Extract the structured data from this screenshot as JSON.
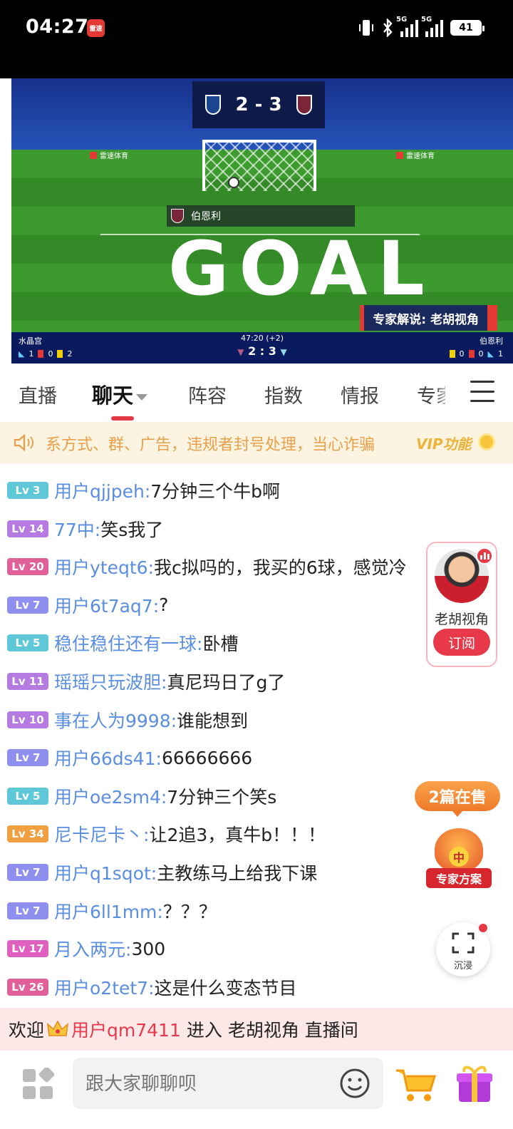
{
  "status_bar": {
    "time": "04:27",
    "app_icon_text": "雷速",
    "network_1": "5G",
    "network_2": "5G",
    "battery": "41"
  },
  "video": {
    "score": "2 - 3",
    "board_ad_text": "雷速体育",
    "scorer_team": "伯恩利",
    "goal_text": "GOAL",
    "expert_tag": "专家解说: 老胡视角",
    "home_team": "水晶宫",
    "away_team": "伯恩利",
    "match_time": "47:20 (+2)",
    "home_score": "2",
    "away_score": "3",
    "score_separator": ":",
    "home_stats": {
      "corners": "1",
      "red": "0",
      "yellow": "2"
    },
    "away_stats": {
      "yellow": "0",
      "red": "0",
      "corners": "1"
    },
    "home_crest_color": "#1b458f",
    "away_crest_color": "#7a263a"
  },
  "tabs": [
    {
      "label": "直播"
    },
    {
      "label": "聊天",
      "active": true
    },
    {
      "label": "阵容"
    },
    {
      "label": "指数"
    },
    {
      "label": "情报"
    },
    {
      "label": "专家"
    }
  ],
  "notice": {
    "text": "系方式、群、广告，违规者封号处理，当心诈骗",
    "vip_label": "VIP功能"
  },
  "chat": [
    {
      "level": "Lv 3",
      "level_color": "#5ec8d8",
      "user": "用户qjjpeh:",
      "message": "7分钟三个牛b啊"
    },
    {
      "level": "Lv 14",
      "level_color": "#b57be0",
      "user": "77中:",
      "message": "笑s我了"
    },
    {
      "level": "Lv 20",
      "level_color": "#e0609a",
      "user": "用户yteqt6:",
      "message": "我c拟吗的，我买的6球，感觉冷"
    },
    {
      "level": "Lv 7",
      "level_color": "#8f8ff0",
      "user": "用户6t7aq7:",
      "message": "?"
    },
    {
      "level": "Lv 5",
      "level_color": "#5ec8d8",
      "user": "稳住稳住还有一球:",
      "message": "卧槽"
    },
    {
      "level": "Lv 11",
      "level_color": "#b57be0",
      "user": "瑶瑶只玩波胆:",
      "message": "真尼玛日了g了"
    },
    {
      "level": "Lv 10",
      "level_color": "#b57be0",
      "user": "事在人为9998:",
      "message": "谁能想到"
    },
    {
      "level": "Lv 7",
      "level_color": "#8f8ff0",
      "user": "用户66ds41:",
      "message": "66666666"
    },
    {
      "level": "Lv 5",
      "level_color": "#5ec8d8",
      "user": "用户oe2sm4:",
      "message": "7分钟三个笑s"
    },
    {
      "level": "Lv 34",
      "level_color": "#f0a040",
      "user": "尼卡尼卡丶:",
      "message": "让2追3，真牛b！！！"
    },
    {
      "level": "Lv 7",
      "level_color": "#8f8ff0",
      "user": "用户q1sqot:",
      "message": "主教练马上给我下课"
    },
    {
      "level": "Lv 7",
      "level_color": "#8f8ff0",
      "user": "用户6ll1mm:",
      "message": "？？？"
    },
    {
      "level": "Lv 17",
      "level_color": "#e060c0",
      "user": "月入两元:",
      "message": "300"
    },
    {
      "level": "Lv 26",
      "level_color": "#e0609a",
      "user": "用户o2tet7:",
      "message": "这是什么变态节目"
    }
  ],
  "streamer_card": {
    "name": "老胡视角",
    "subscribe_label": "订阅"
  },
  "expert_plan": {
    "badge": "2篇在售",
    "bag_mark": "中",
    "label": "专家方案"
  },
  "immersive": {
    "label": "沉浸"
  },
  "welcome": {
    "prefix": "欢迎",
    "user": "用户qm7411",
    "suffix": "进入 老胡视角 直播间"
  },
  "input": {
    "placeholder": "跟大家聊聊呗"
  }
}
